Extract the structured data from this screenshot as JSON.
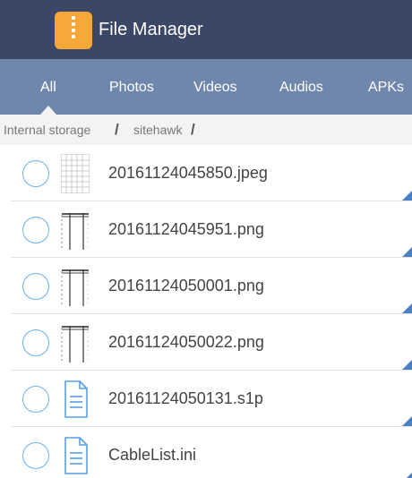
{
  "app": {
    "title": "File Manager",
    "icon": "zip-archive-icon"
  },
  "tabs": [
    {
      "label": "All",
      "selected": true
    },
    {
      "label": "Photos",
      "selected": false
    },
    {
      "label": "Videos",
      "selected": false
    },
    {
      "label": "Audios",
      "selected": false
    },
    {
      "label": "APKs",
      "selected": false
    }
  ],
  "breadcrumb": {
    "items": [
      "Internal storage",
      "sitehawk"
    ],
    "separator": "/"
  },
  "files": [
    {
      "name": "20161124045850.jpeg",
      "icon": "image-grid-thumbnail-icon",
      "selected": false
    },
    {
      "name": "20161124045951.png",
      "icon": "image-thumbnail-icon",
      "selected": false
    },
    {
      "name": "20161124050001.png",
      "icon": "image-thumbnail-icon",
      "selected": false
    },
    {
      "name": "20161124050022.png",
      "icon": "image-thumbnail-icon",
      "selected": false
    },
    {
      "name": "20161124050131.s1p",
      "icon": "document-icon",
      "selected": false
    },
    {
      "name": "CableList.ini",
      "icon": "document-icon",
      "selected": false
    }
  ],
  "colors": {
    "header": "#3a4767",
    "tabs": "#6f87ad",
    "accent": "#4a7fc1",
    "radio": "#6ab2ea",
    "app_icon": "#f7a839"
  }
}
